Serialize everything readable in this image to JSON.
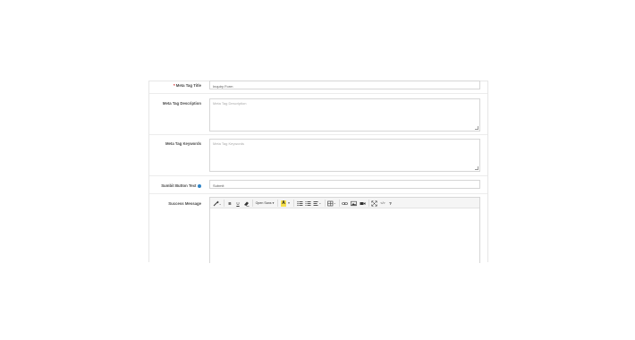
{
  "form": {
    "meta_title": {
      "required_marker": "*",
      "label": "Meta Tag Title",
      "value": "Inquiry Form"
    },
    "meta_description": {
      "label": "Meta Tag Description",
      "placeholder": "Meta Tag Description"
    },
    "meta_keywords": {
      "label": "Meta Tag Keywords",
      "placeholder": "Meta Tag Keywords"
    },
    "submit_text": {
      "label": "Sumbit Button Text",
      "value": "Submit",
      "help_icon": "info-circle-icon"
    },
    "success_message": {
      "label": "Success Message"
    }
  },
  "editor_toolbar": {
    "style_icon": "magic-wand-icon",
    "bold": "B",
    "underline": "U",
    "clear_format": "eraser-icon",
    "font_family": "Open Sans",
    "color_letter": "A",
    "highlight_color": "#f6e04d",
    "unordered_list": "unordered-list-icon",
    "ordered_list": "ordered-list-icon",
    "paragraph": "align-icon",
    "table": "table-icon",
    "link": "link-icon",
    "picture": "picture-icon",
    "video": "video-icon",
    "fullscreen": "fullscreen-icon",
    "code_view": "</>",
    "help": "?"
  }
}
